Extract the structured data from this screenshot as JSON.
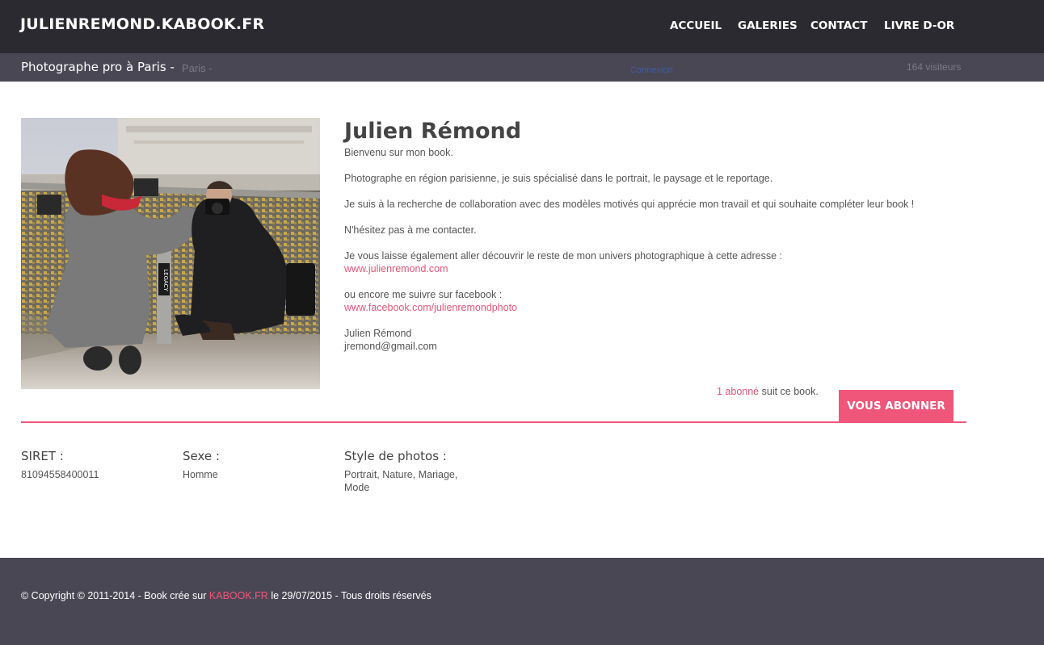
{
  "header": {
    "brand": "JULIENREMOND.KABOOK.FR",
    "nav": [
      "ACCUEIL",
      "GALERIES",
      "CONTACT",
      "LIVRE D-OR"
    ]
  },
  "subheader": {
    "title": "Photographe pro à Paris -",
    "city": "Paris -",
    "login": "Connexion",
    "visitors": "164 visiteurs"
  },
  "profile": {
    "name": "Julien Rémond",
    "welcome": "Bienvenu sur mon book.",
    "intro": "Photographe en région parisienne, je suis spécialisé dans le portrait, le paysage et le reportage.",
    "search": "Je suis à la recherche de collaboration avec des modèles motivés qui apprécie mon travail et qui souhaite compléter leur book !",
    "contact_prompt": "N'hésitez pas à me contacter.",
    "website_intro": "Je vous laisse également aller découvrir le reste de mon univers photographique à cette adresse :",
    "website_link": "www.julienremond.com",
    "facebook_intro": "ou encore me suivre sur facebook :",
    "facebook_link": "www.facebook.com/julienremondphoto",
    "signature_name": "Julien Rémond",
    "signature_email": "jremond@gmail.com",
    "photo_text": "LEGACY"
  },
  "subscription": {
    "count_text": "1 abonné",
    "suffix": "suit ce book.",
    "button": "VOUS ABONNER"
  },
  "details": {
    "siret_label": "SIRET :",
    "siret_value": "81094558400011",
    "sexe_label": "Sexe :",
    "sexe_value": "Homme",
    "style_label": "Style de photos :",
    "style_value": "Portrait, Nature, Mariage, Mode"
  },
  "footer": {
    "prefix": "© Copyright © 2011-2014 - Book crée sur",
    "link": "KABOOK.FR",
    "suffix": "le 29/07/2015 - Tous droits réservés"
  },
  "colors": {
    "topbar": "#2b2a30",
    "subbar": "#4a4755",
    "accent": "#f0567a"
  }
}
